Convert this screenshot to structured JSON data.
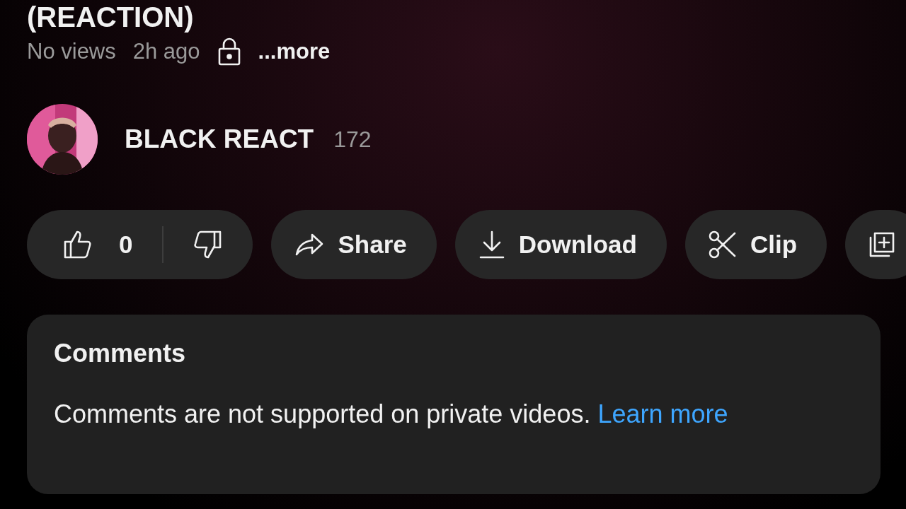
{
  "video": {
    "title": "(REACTION)",
    "views": "No views",
    "age": "2h ago",
    "more": "...more"
  },
  "channel": {
    "name": "BLACK REACT",
    "subscribers": "172"
  },
  "actions": [
    {
      "kind": "like",
      "count": "0"
    },
    {
      "kind": "share",
      "label": "Share"
    },
    {
      "kind": "download",
      "label": "Download"
    },
    {
      "kind": "clip",
      "label": "Clip"
    },
    {
      "kind": "save"
    }
  ],
  "comments": {
    "title": "Comments",
    "message": "Comments are not supported on private videos.",
    "link": "Learn more"
  }
}
